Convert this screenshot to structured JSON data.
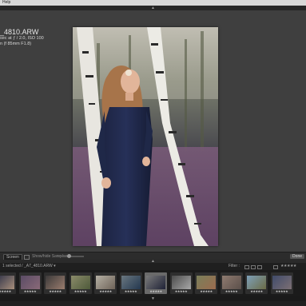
{
  "menubar": {
    "label": "Help"
  },
  "panel_toggles": {
    "top": "▲",
    "middle": "▲",
    "bottom": "▼"
  },
  "photo_info": {
    "filename": "_4810.ARW",
    "exposure": "sec at ƒ / 2.0, ISO 100",
    "lens": "n (f 85mm F1.8)"
  },
  "toolbar": {
    "view_button": "Screen",
    "sample_label": "Show/hide Samples",
    "done_button": "Done"
  },
  "filmstrip_header": {
    "selection_text": "1 selected / _A7_4810.ARW ▾",
    "filter_label": "Filter :",
    "rating_stars": "★★★★★"
  },
  "filmstrip": {
    "thumbnails": [
      {
        "stars": "★★★★★",
        "selected": false,
        "colors": [
          "#2b2f45",
          "#a88f7c"
        ]
      },
      {
        "stars": "★★★★★",
        "selected": false,
        "colors": [
          "#5a4b65",
          "#8a6a78"
        ]
      },
      {
        "stars": "★★★★★",
        "selected": false,
        "colors": [
          "#3c3a3a",
          "#9a7d6e"
        ]
      },
      {
        "stars": "★★★★★",
        "selected": false,
        "colors": [
          "#8b8b6a",
          "#4e5a3a"
        ]
      },
      {
        "stars": "★★★★★",
        "selected": false,
        "colors": [
          "#b5b0a4",
          "#6e6358"
        ]
      },
      {
        "stars": "★★★★★",
        "selected": false,
        "colors": [
          "#6a7780",
          "#24384f"
        ]
      },
      {
        "stars": "★★★★★",
        "selected": true,
        "colors": [
          "#7a7a7a",
          "#1f2236"
        ]
      },
      {
        "stars": "★★★★★",
        "selected": false,
        "colors": [
          "#4c4c4c",
          "#a8a8a8"
        ]
      },
      {
        "stars": "★★★★★",
        "selected": false,
        "colors": [
          "#7a7f5a",
          "#9b6b4e"
        ]
      },
      {
        "stars": "★★★★★",
        "selected": false,
        "colors": [
          "#8f7b70",
          "#5b4f4a"
        ]
      },
      {
        "stars": "★★★★★",
        "selected": false,
        "colors": [
          "#7ea0b8",
          "#6b6b46"
        ]
      },
      {
        "stars": "★★★★★",
        "selected": false,
        "colors": [
          "#404b6a",
          "#7c6f74"
        ]
      }
    ]
  }
}
